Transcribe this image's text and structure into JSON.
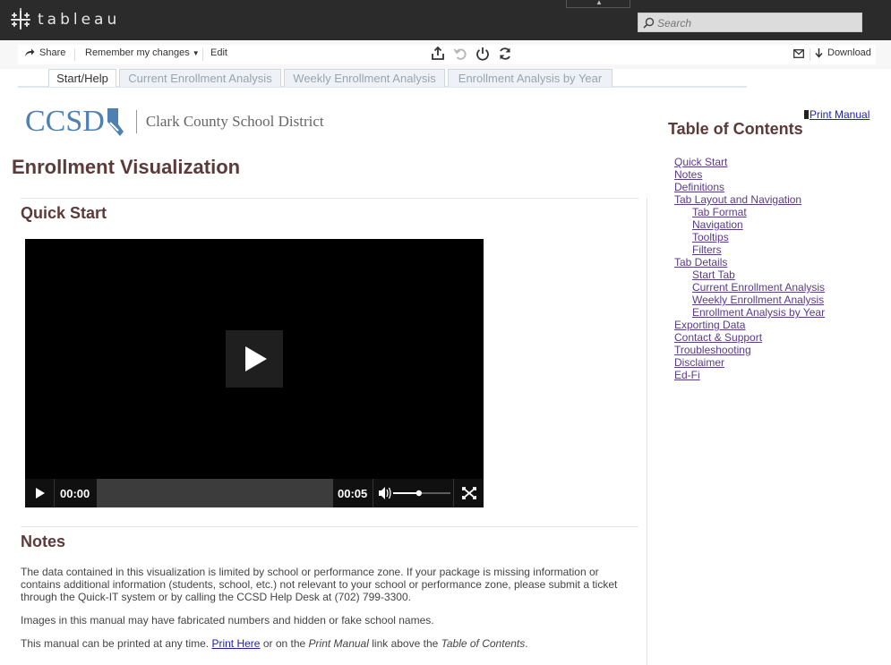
{
  "app": {
    "brand": "tableau"
  },
  "search": {
    "placeholder": "Search"
  },
  "toolbar": {
    "share": "Share",
    "remember": "Remember my changes",
    "edit": "Edit",
    "download": "Download"
  },
  "tabs": [
    "Start/Help",
    "Current Enrollment Analysis",
    "Weekly Enrollment Analysis",
    "Enrollment Analysis by Year"
  ],
  "org": {
    "acronym": "CCSD",
    "name": "Clark County School District"
  },
  "page": {
    "title": "Enrollment Visualization"
  },
  "quick_start": {
    "title": "Quick Start"
  },
  "video": {
    "current_time": "00:00",
    "duration": "00:05",
    "volume": 0.45
  },
  "notes": {
    "title": "Notes",
    "p1": "The data contained in this visualization is limited by school or performance zone. If your package is missing information or contains additional information (students, school, etc.) not relevant to your school or performance zone, please submit a ticket through the Quick-IT system or by calling the CCSD Help Desk at (702) 799-3300.",
    "p2": "Images in this manual may have fabricated numbers and hidden or fake school names.",
    "p3_pre": "This manual can be printed at any time. ",
    "p3_link": "Print Here",
    "p3_mid": " or on the ",
    "p3_em": "Print Manual",
    "p3_post": " link above the ",
    "p3_em2": "Table of Contents",
    "p3_end": "."
  },
  "sidebar": {
    "print_manual": "Print Manual",
    "toc_title": "Table of Contents",
    "items": [
      {
        "label": "Quick Start",
        "level": 0
      },
      {
        "label": "Notes",
        "level": 0
      },
      {
        "label": "Definitions",
        "level": 0
      },
      {
        "label": "Tab Layout and Navigation",
        "level": 0
      },
      {
        "label": "Tab Format",
        "level": 1
      },
      {
        "label": "Navigation",
        "level": 1
      },
      {
        "label": "Tooltips",
        "level": 1
      },
      {
        "label": "Filters",
        "level": 1
      },
      {
        "label": "Tab Details",
        "level": 0
      },
      {
        "label": "Start Tab",
        "level": 1
      },
      {
        "label": "Current Enrollment Analysis",
        "level": 1
      },
      {
        "label": "Weekly Enrollment Analysis",
        "level": 1
      },
      {
        "label": "Enrollment Analysis by Year",
        "level": 1
      },
      {
        "label": "Exporting Data",
        "level": 0
      },
      {
        "label": "Contact & Support",
        "level": 0
      },
      {
        "label": "Troubleshooting",
        "level": 0
      },
      {
        "label": "Disclaimer",
        "level": 0
      },
      {
        "label": "Ed-Fi",
        "level": 0
      }
    ]
  }
}
